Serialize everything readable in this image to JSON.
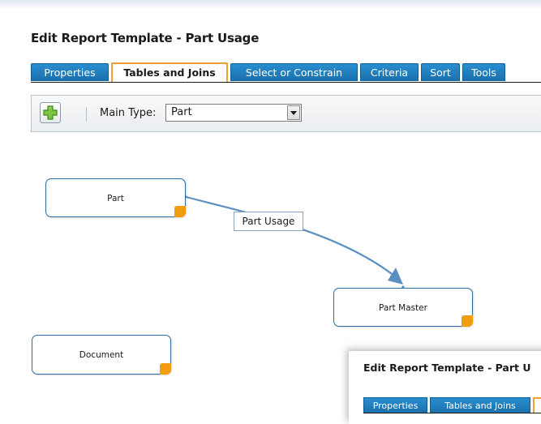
{
  "page": {
    "title": "Edit Report Template - Part Usage"
  },
  "tabs": [
    {
      "label": "Properties",
      "active": false
    },
    {
      "label": "Tables and Joins",
      "active": true
    },
    {
      "label": "Select or Constrain",
      "active": false
    },
    {
      "label": "Criteria",
      "active": false
    },
    {
      "label": "Sort",
      "active": false
    },
    {
      "label": "Tools",
      "active": false
    }
  ],
  "toolbar": {
    "add_icon": "plus-icon",
    "main_type_label": "Main Type:",
    "main_type_value": "Part"
  },
  "diagram": {
    "nodes": [
      {
        "label": "Part"
      },
      {
        "label": "Part Master"
      },
      {
        "label": "Document"
      }
    ],
    "join": {
      "label": "Part Usage",
      "from": "Part",
      "to": "Part Master"
    }
  },
  "overlay_window": {
    "title": "Edit Report Template - Part U",
    "tabs": [
      {
        "label": "Properties"
      },
      {
        "label": "Tables and Joins"
      }
    ]
  },
  "colors": {
    "tab_blue": "#1f7fc0",
    "active_tab_border": "#f0a030",
    "node_handle": "#f29c11",
    "join_arrow": "#5b8fc2"
  }
}
